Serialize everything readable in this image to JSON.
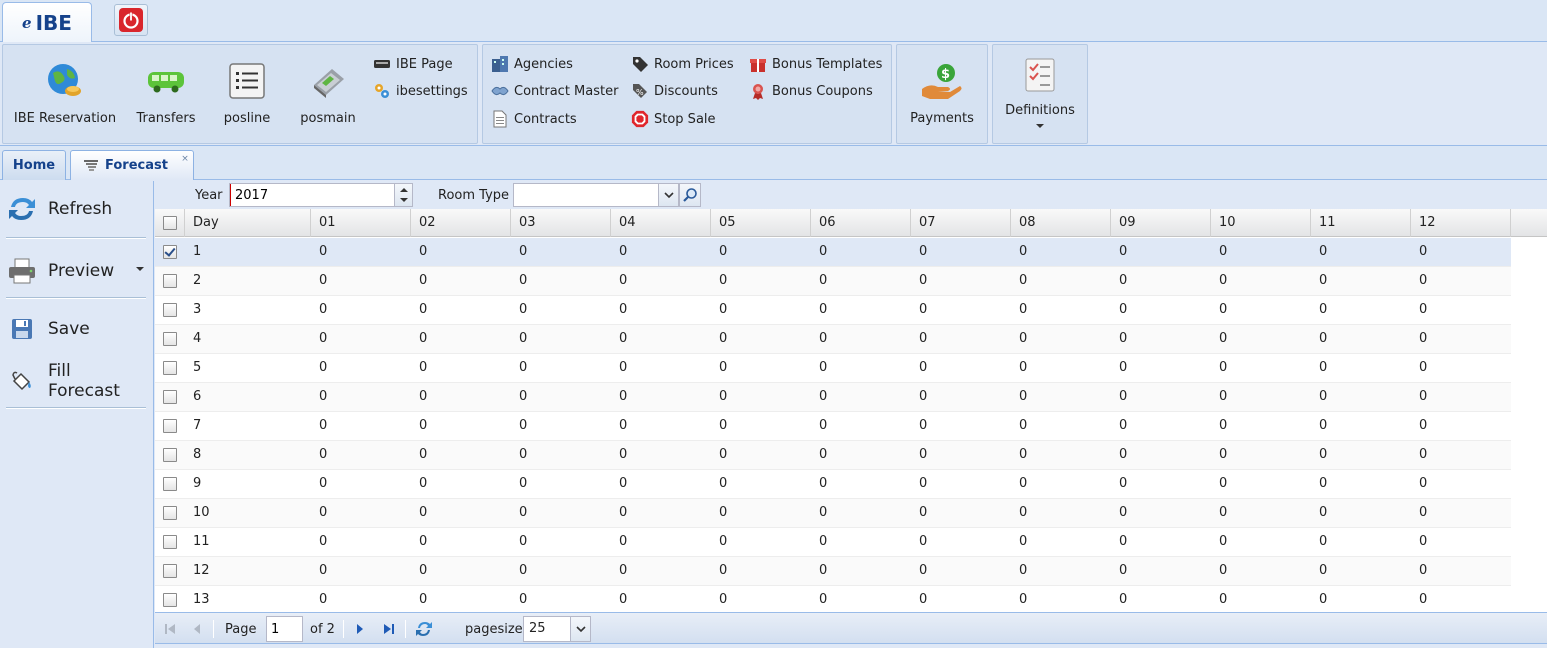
{
  "app": {
    "logo_mark": "e",
    "name": "IBE"
  },
  "ribbon": {
    "big_buttons": [
      {
        "key": "ibe-reservation",
        "label": "IBE Reservation"
      },
      {
        "key": "transfers",
        "label": "Transfers"
      },
      {
        "key": "posline",
        "label": "posline"
      },
      {
        "key": "posmain",
        "label": "posmain"
      }
    ],
    "small_col1": [
      {
        "key": "ibe-page",
        "label": "IBE Page"
      },
      {
        "key": "ibesettings",
        "label": "ibesettings"
      }
    ],
    "group2": [
      {
        "key": "agencies",
        "label": "Agencies"
      },
      {
        "key": "contract-master",
        "label": "Contract Master"
      },
      {
        "key": "contracts",
        "label": "Contracts"
      },
      {
        "key": "room-prices",
        "label": "Room Prices"
      },
      {
        "key": "discounts",
        "label": "Discounts"
      },
      {
        "key": "stop-sale",
        "label": "Stop Sale"
      },
      {
        "key": "bonus-templates",
        "label": "Bonus Templates"
      },
      {
        "key": "bonus-coupons",
        "label": "Bonus Coupons"
      }
    ],
    "payments_label": "Payments",
    "definitions_label": "Definitions"
  },
  "tabs": [
    {
      "label": "Home"
    },
    {
      "label": "Forecast",
      "close": "×"
    }
  ],
  "left_panel": {
    "refresh": "Refresh",
    "preview": "Preview",
    "save": "Save",
    "fill_forecast": "Fill Forecast"
  },
  "filter": {
    "year_label": "Year",
    "year_value": "2017",
    "room_type_label": "Room Type",
    "room_type_value": ""
  },
  "grid": {
    "columns": [
      "Day",
      "01",
      "02",
      "03",
      "04",
      "05",
      "06",
      "07",
      "08",
      "09",
      "10",
      "11",
      "12"
    ],
    "rows": [
      {
        "day": "1",
        "checked": true,
        "values": [
          "0",
          "0",
          "0",
          "0",
          "0",
          "0",
          "0",
          "0",
          "0",
          "0",
          "0",
          "0"
        ]
      },
      {
        "day": "2",
        "checked": false,
        "values": [
          "0",
          "0",
          "0",
          "0",
          "0",
          "0",
          "0",
          "0",
          "0",
          "0",
          "0",
          "0"
        ]
      },
      {
        "day": "3",
        "checked": false,
        "values": [
          "0",
          "0",
          "0",
          "0",
          "0",
          "0",
          "0",
          "0",
          "0",
          "0",
          "0",
          "0"
        ]
      },
      {
        "day": "4",
        "checked": false,
        "values": [
          "0",
          "0",
          "0",
          "0",
          "0",
          "0",
          "0",
          "0",
          "0",
          "0",
          "0",
          "0"
        ]
      },
      {
        "day": "5",
        "checked": false,
        "values": [
          "0",
          "0",
          "0",
          "0",
          "0",
          "0",
          "0",
          "0",
          "0",
          "0",
          "0",
          "0"
        ]
      },
      {
        "day": "6",
        "checked": false,
        "values": [
          "0",
          "0",
          "0",
          "0",
          "0",
          "0",
          "0",
          "0",
          "0",
          "0",
          "0",
          "0"
        ]
      },
      {
        "day": "7",
        "checked": false,
        "values": [
          "0",
          "0",
          "0",
          "0",
          "0",
          "0",
          "0",
          "0",
          "0",
          "0",
          "0",
          "0"
        ]
      },
      {
        "day": "8",
        "checked": false,
        "values": [
          "0",
          "0",
          "0",
          "0",
          "0",
          "0",
          "0",
          "0",
          "0",
          "0",
          "0",
          "0"
        ]
      },
      {
        "day": "9",
        "checked": false,
        "values": [
          "0",
          "0",
          "0",
          "0",
          "0",
          "0",
          "0",
          "0",
          "0",
          "0",
          "0",
          "0"
        ]
      },
      {
        "day": "10",
        "checked": false,
        "values": [
          "0",
          "0",
          "0",
          "0",
          "0",
          "0",
          "0",
          "0",
          "0",
          "0",
          "0",
          "0"
        ]
      },
      {
        "day": "11",
        "checked": false,
        "values": [
          "0",
          "0",
          "0",
          "0",
          "0",
          "0",
          "0",
          "0",
          "0",
          "0",
          "0",
          "0"
        ]
      },
      {
        "day": "12",
        "checked": false,
        "values": [
          "0",
          "0",
          "0",
          "0",
          "0",
          "0",
          "0",
          "0",
          "0",
          "0",
          "0",
          "0"
        ]
      },
      {
        "day": "13",
        "checked": false,
        "values": [
          "0",
          "0",
          "0",
          "0",
          "0",
          "0",
          "0",
          "0",
          "0",
          "0",
          "0",
          "0"
        ]
      }
    ]
  },
  "paging": {
    "page_label": "Page",
    "page_value": "1",
    "of_label": "of 2",
    "pagesize_label": "pagesize",
    "pagesize_value": "25"
  },
  "colors": {
    "accent": "#15428b",
    "border": "#99bbe8",
    "power": "#d9262c",
    "selected_row": "#dfe8f6"
  }
}
